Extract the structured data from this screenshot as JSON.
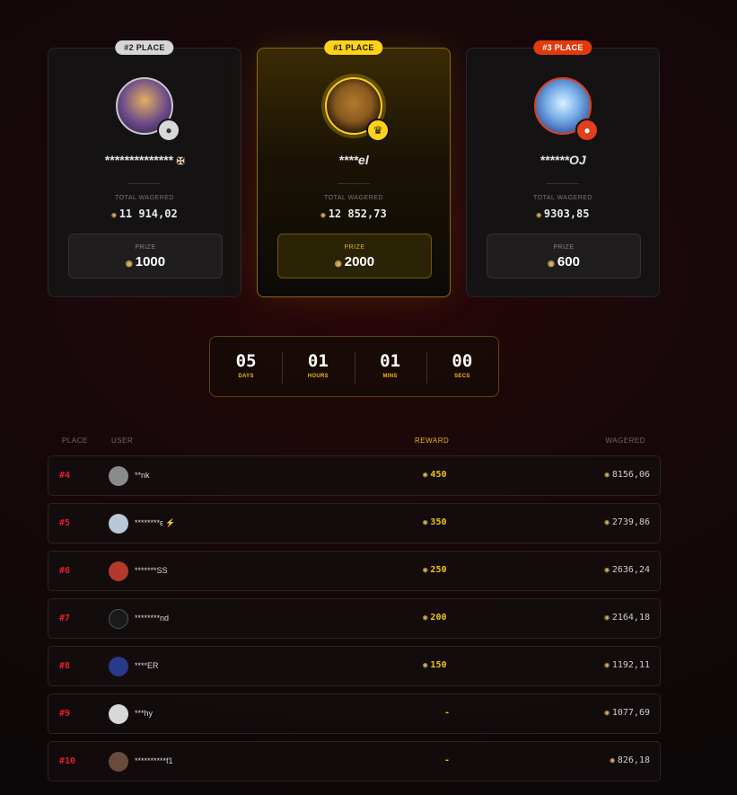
{
  "podium": [
    {
      "pill": "#2 PLACE",
      "name": "**************",
      "wager_label": "TOTAL WAGERED",
      "wager": "11 914,02",
      "prize_label": "PRIZE",
      "prize": "1000",
      "avatar_color": "#6b4a8a",
      "medal_icon": "medal-icon"
    },
    {
      "pill": "#1 PLACE",
      "name": "****el",
      "wager_label": "TOTAL WAGERED",
      "wager": "12 852,73",
      "prize_label": "PRIZE",
      "prize": "2000",
      "avatar_color": "#8a5a1e",
      "medal_icon": "crown-icon"
    },
    {
      "pill": "#3 PLACE",
      "name": "******OJ",
      "wager_label": "TOTAL WAGERED",
      "wager": "9303,85",
      "prize_label": "PRIZE",
      "prize": "600",
      "avatar_color": "#4a7ac8",
      "medal_icon": "medal-icon"
    }
  ],
  "countdown": [
    {
      "value": "05",
      "label": "DAYS"
    },
    {
      "value": "01",
      "label": "HOURS"
    },
    {
      "value": "01",
      "label": "MINS"
    },
    {
      "value": "00",
      "label": "SECS"
    }
  ],
  "table": {
    "headers": {
      "place": "PLACE",
      "user": "USER",
      "reward": "REWARD",
      "wagered": "WAGERED"
    },
    "rows": [
      {
        "place": "#4",
        "user": "**nk",
        "reward": "450",
        "wagered": "8156,06",
        "avatar_color": "#8a8a8a"
      },
      {
        "place": "#5",
        "user": "********ε",
        "reward": "350",
        "wagered": "2739,86",
        "avatar_color": "#b8c8d8"
      },
      {
        "place": "#6",
        "user": "*******SS",
        "reward": "250",
        "wagered": "2636,24",
        "avatar_color": "#b23a2a"
      },
      {
        "place": "#7",
        "user": "********nd",
        "reward": "200",
        "wagered": "2164,18",
        "avatar_color": "#1a1a1a"
      },
      {
        "place": "#8",
        "user": "****ER",
        "reward": "150",
        "wagered": "1192,11",
        "avatar_color": "#2a3a8a"
      },
      {
        "place": "#9",
        "user": "***hy",
        "reward": "-",
        "wagered": "1077,69",
        "avatar_color": "#d8d8d8"
      },
      {
        "place": "#10",
        "user": "**********f1",
        "reward": "-",
        "wagered": "826,18",
        "avatar_color": "#6a4a3a"
      }
    ]
  },
  "colors": {
    "gold": "#ffd21a",
    "silver": "#d6d6d6",
    "bronze": "#e13a0e",
    "place_red": "#e0202a"
  }
}
